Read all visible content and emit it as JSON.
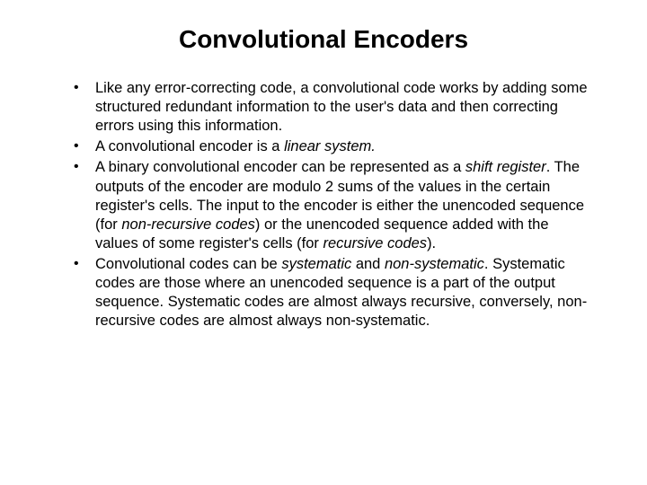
{
  "title": "Convolutional Encoders",
  "bullets": {
    "b1": "Like any error-correcting code, a convolutional code works by adding some structured redundant information to the user's data and then correcting errors using this information.",
    "b2_a": "A convolutional encoder is a ",
    "b2_i": "linear system.",
    "b3_a": "A binary convolutional encoder can be represented as a ",
    "b3_i1": "shift register",
    "b3_b": ". The outputs of the encoder are modulo 2 sums of the values in the certain register's cells. The input to the encoder is either the unencoded sequence (for ",
    "b3_i2": "non-recursive codes",
    "b3_c": ") or the unencoded sequence added with the values of some register's cells (for ",
    "b3_i3": "recursive codes",
    "b3_d": ").",
    "b4_a": "Convolutional codes can be ",
    "b4_i1": "systematic",
    "b4_b": " and ",
    "b4_i2": "non-systematic",
    "b4_c": ". Systematic codes are those where an unencoded sequence is a part of the output sequence. Systematic codes are almost always recursive, conversely, non-recursive codes are almost always non-systematic."
  }
}
